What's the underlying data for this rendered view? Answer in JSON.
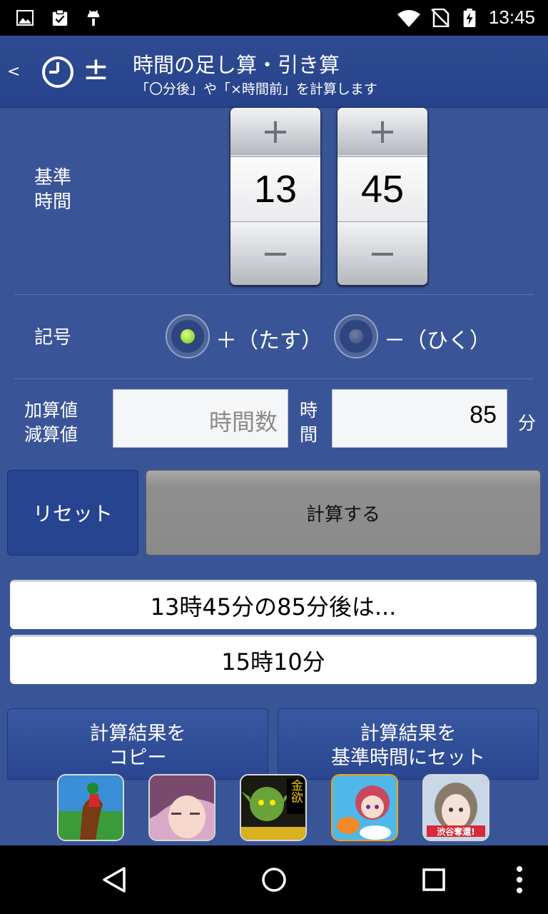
{
  "status_bar": {
    "time": "13:45",
    "icons": [
      "image-icon",
      "clipboard-check-icon",
      "android-icon",
      "wifi-icon",
      "no-sim-icon",
      "battery-charging-icon"
    ]
  },
  "app_bar": {
    "back": "<",
    "title": "時間の足し算・引き算",
    "subtitle": "「〇分後」や「×時間前」を計算します",
    "plus_minus": "±"
  },
  "base_time": {
    "label_line1": "基準",
    "label_line2": "時間",
    "hour": "13",
    "minute": "45",
    "plus_glyph": "+",
    "minus_glyph": "−"
  },
  "sign": {
    "label": "記号",
    "option_plus": "＋（たす）",
    "option_minus": "－（ひく）",
    "selected": "plus"
  },
  "amount": {
    "label_line1": "加算値",
    "label_line2": "減算値",
    "hours_placeholder": "時間数",
    "hours_unit_line1": "時",
    "hours_unit_line2": "間",
    "minutes_value": "85",
    "minutes_unit": "分"
  },
  "buttons": {
    "reset": "リセット",
    "calculate": "計算する",
    "copy_line1": "計算結果を",
    "copy_line2": "コピー",
    "set_line1": "計算結果を",
    "set_line2": "基準時間にセット"
  },
  "result": {
    "description": "13時45分の85分後は...",
    "value": "15時10分"
  },
  "ads": {
    "badge_5": "渋谷奪還!",
    "badge_3": "金欲"
  },
  "colors": {
    "background": "#3a5597",
    "app_bar": "#2a4690",
    "radio_selected": "#9bd62a"
  }
}
